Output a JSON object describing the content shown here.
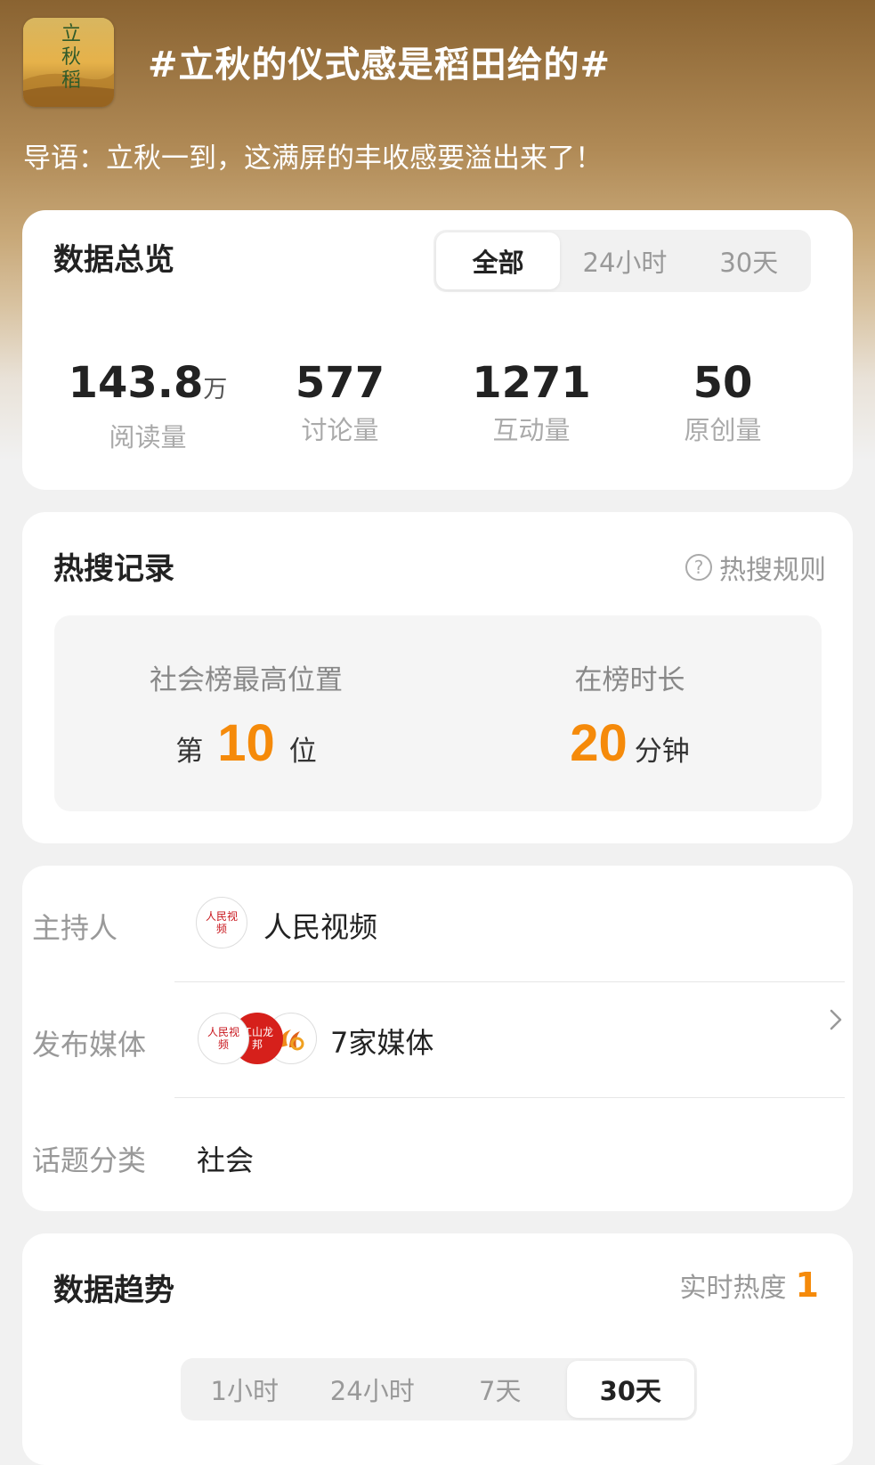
{
  "header": {
    "topic_thumbnail": "立秋稻",
    "title": "#立秋的仪式感是稻田给的#",
    "intro": "导语：立秋一到，这满屏的丰收感要溢出来了！"
  },
  "overview": {
    "title": "数据总览",
    "tabs": [
      {
        "label": "全部",
        "active": true
      },
      {
        "label": "24小时",
        "active": false
      },
      {
        "label": "30天",
        "active": false
      }
    ],
    "stats": [
      {
        "value": "143.8",
        "unit": "万",
        "label": "阅读量"
      },
      {
        "value": "577",
        "unit": "",
        "label": "讨论量"
      },
      {
        "value": "1271",
        "unit": "",
        "label": "互动量"
      },
      {
        "value": "50",
        "unit": "",
        "label": "原创量"
      }
    ]
  },
  "hot_search": {
    "title": "热搜记录",
    "rule_link": "热搜规则",
    "rank": {
      "label": "社会榜最高位置",
      "prefix": "第",
      "value": "10",
      "suffix": "位"
    },
    "duration": {
      "label": "在榜时长",
      "value": "20",
      "suffix": "分钟"
    }
  },
  "info": {
    "host_label": "主持人",
    "host_name": "人民视频",
    "host_avatar_text": "人民视频",
    "media_label": "发布媒体",
    "media_count": "7家媒体",
    "media_avatar_texts": [
      "人民视频",
      "江山龙邦"
    ],
    "category_label": "话题分类",
    "category_value": "社会"
  },
  "trend": {
    "title": "数据趋势",
    "realtime_label": "实时热度",
    "realtime_value": "1",
    "tabs": [
      {
        "label": "1小时",
        "active": false
      },
      {
        "label": "24小时",
        "active": false
      },
      {
        "label": "7天",
        "active": false
      },
      {
        "label": "30天",
        "active": true
      }
    ]
  },
  "colors": {
    "accent_orange": "#f58a0a",
    "header_brown": "#8a6331",
    "card_bg": "#ffffff",
    "page_bg": "#f1f1f1"
  },
  "icons": [
    "help-circle-icon",
    "chevron-right-icon"
  ]
}
